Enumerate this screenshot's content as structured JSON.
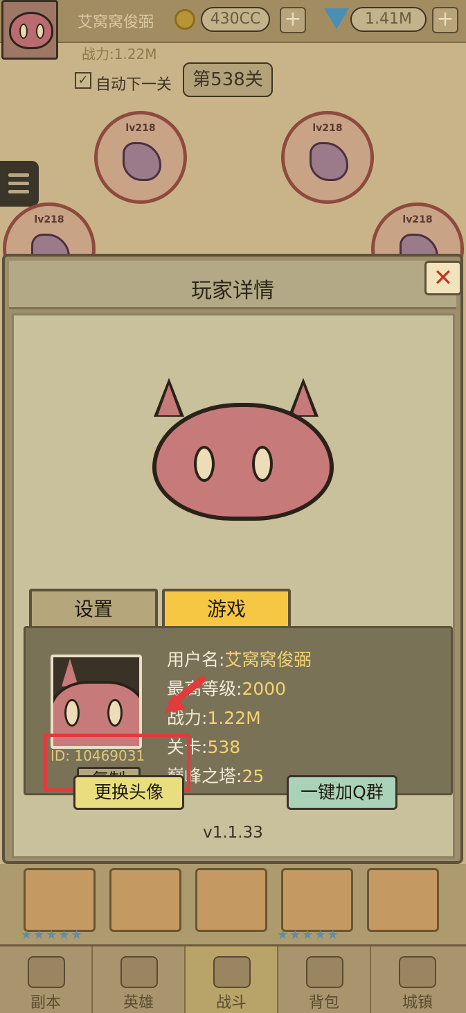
{
  "hud": {
    "player_name": "艾窝窝俊弼",
    "combat_power": "战力:1.22M",
    "gold": "430CC",
    "gems": "1.41M",
    "auto_next_label": "自动下一关",
    "auto_next_checked": true,
    "stage": "第538关",
    "plus": "+"
  },
  "enemies": [
    {
      "label": "lv218"
    },
    {
      "label": "lv218"
    },
    {
      "label": "lv218"
    },
    {
      "label": "lv218"
    }
  ],
  "bottom_nav": [
    {
      "label": "副本",
      "icon": "map-icon"
    },
    {
      "label": "英雄",
      "icon": "helmet-icon"
    },
    {
      "label": "战斗",
      "icon": "crossed-swords-icon",
      "active": true
    },
    {
      "label": "背包",
      "icon": "backpack-icon"
    },
    {
      "label": "城镇",
      "icon": "shop-icon"
    }
  ],
  "dialog": {
    "title": "玩家详情",
    "close": "✕",
    "tabs": {
      "settings": "设置",
      "game": "游戏"
    },
    "player": {
      "id_label": "ID: 10469031",
      "copy_label": "复制",
      "stats": [
        {
          "key": "用户名:",
          "value": "艾窝窝俊弼"
        },
        {
          "key": "最高等级:",
          "value": "2000"
        },
        {
          "key": "战力:",
          "value": "1.22M"
        },
        {
          "key": "关卡:",
          "value": "538"
        },
        {
          "key": "巅峰之塔:",
          "value": "25"
        }
      ]
    },
    "buttons": {
      "change_avatar": "更换头像",
      "join_qq": "一键加Q群"
    },
    "version": "v1.1.33"
  },
  "colors": {
    "accent": "#f6c743",
    "highlight_annotation": "#e23b3b",
    "avatar_pink": "#c77a7a"
  }
}
